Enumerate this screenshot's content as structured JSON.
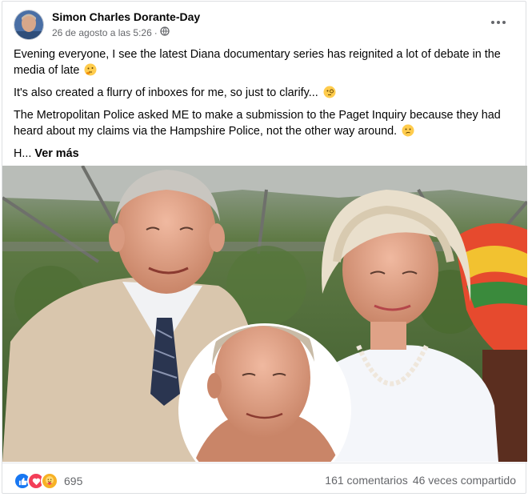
{
  "post": {
    "author": "Simon Charles Dorante-Day",
    "timestamp": "26 de agosto a las 5:26",
    "separator": "·",
    "audience_icon": "globe-icon",
    "menu_icon": "more-options-icon",
    "paragraphs": [
      "Evening everyone, I see the latest Diana documentary series has reignited a lot of debate in the media of late",
      "It's also created a flurry of inboxes for me, so just to clarify...",
      "The Metropolitan Police asked ME to make a submission to the Paget Inquiry because they had heard about my claims via the Hampshire Police, not the other way around."
    ],
    "truncated_text": "H...",
    "see_more": "Ver más"
  },
  "footer": {
    "reaction_icons": [
      "like-icon",
      "love-icon",
      "care-icon"
    ],
    "reaction_count": "695",
    "comments": "161 comentarios",
    "shares": "46 veces compartido"
  },
  "colors": {
    "like": "#1877f2",
    "love": "#f33e58",
    "care": "#f7b125",
    "secondary_text": "#65676b"
  }
}
